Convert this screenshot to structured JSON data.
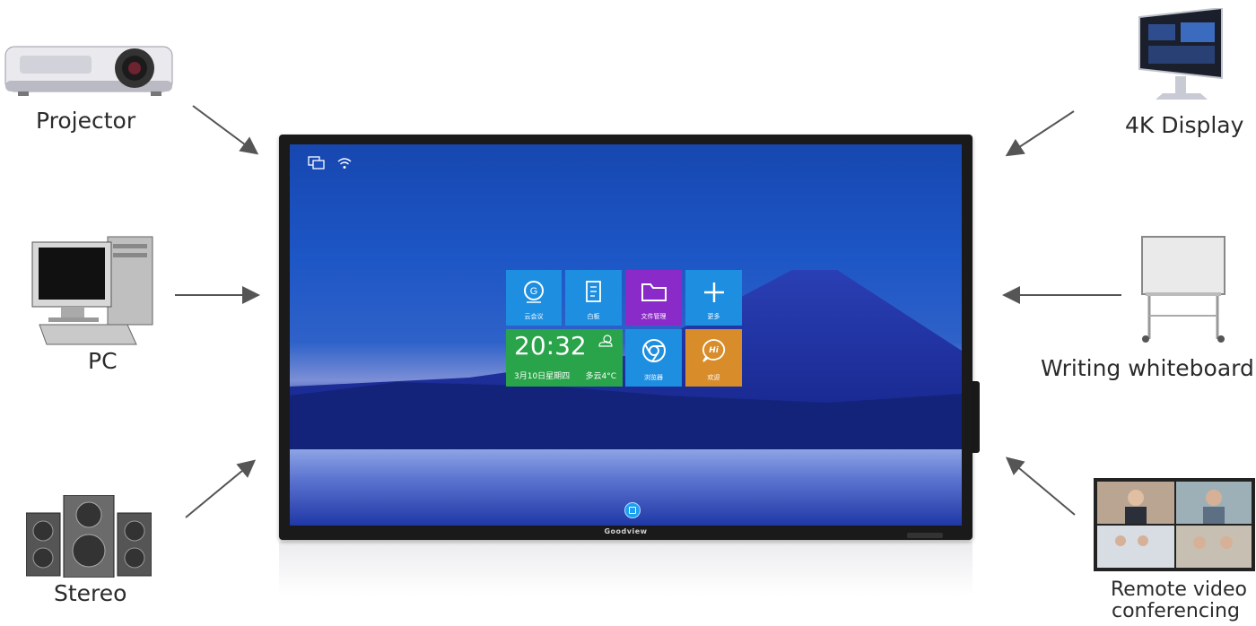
{
  "devices": {
    "projector": "Projector",
    "pc": "PC",
    "stereo": "Stereo",
    "display_4k": "4K Display",
    "whiteboard": "Writing whiteboard",
    "video_line1": "Remote video",
    "video_line2": "conferencing"
  },
  "panel": {
    "brand": "Goodview",
    "tiles": {
      "meeting": "云会议",
      "whiteboard": "白板",
      "files": "文件管理",
      "more": "更多",
      "browser": "浏览器",
      "welcome": "欢迎",
      "welcome_glyph": "Hi"
    },
    "clock": {
      "time": "20:32",
      "date": "3月10日星期四",
      "weather": "多云4°C"
    }
  },
  "icons": [
    "projector-icon",
    "pc-icon",
    "stereo-icon",
    "monitor-icon",
    "whiteboard-icon",
    "video-conference-icon",
    "screen-share-icon",
    "wifi-icon",
    "home-icon"
  ]
}
